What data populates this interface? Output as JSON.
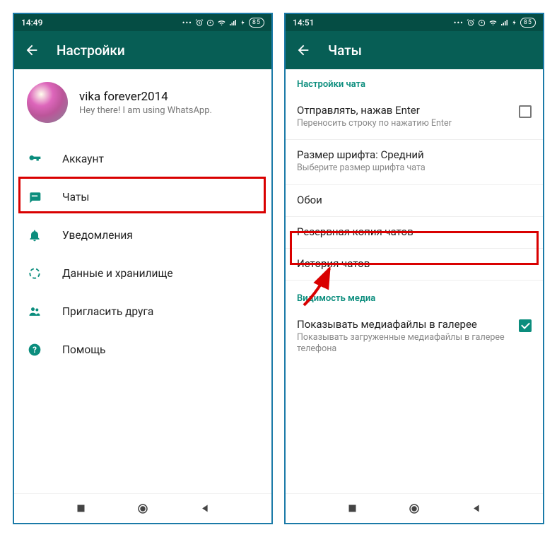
{
  "left": {
    "status": {
      "time": "14:49",
      "battery": "85"
    },
    "appbar_title": "Настройки",
    "profile": {
      "name": "vika forever2014",
      "status": "Hey there! I am using WhatsApp."
    },
    "items": [
      {
        "label": "Аккаунт"
      },
      {
        "label": "Чаты"
      },
      {
        "label": "Уведомления"
      },
      {
        "label": "Данные и хранилище"
      },
      {
        "label": "Пригласить друга"
      },
      {
        "label": "Помощь"
      }
    ]
  },
  "right": {
    "status": {
      "time": "14:51",
      "battery": "85"
    },
    "appbar_title": "Чаты",
    "section1_header": "Настройки чата",
    "items1": [
      {
        "title": "Отправлять, нажав Enter",
        "sub": "Переносить строку по нажатию Enter"
      },
      {
        "title": "Размер шрифта: Средний",
        "sub": "Выберите размер шрифта чата"
      },
      {
        "title": "Обои",
        "sub": ""
      },
      {
        "title": "Резервная копия чатов",
        "sub": ""
      },
      {
        "title": "История чатов",
        "sub": ""
      }
    ],
    "section2_header": "Видимость медиа",
    "items2": [
      {
        "title": "Показывать медиафайлы в галерее",
        "sub": "Показывать загруженные медиафайлы в галерее телефона"
      }
    ]
  }
}
